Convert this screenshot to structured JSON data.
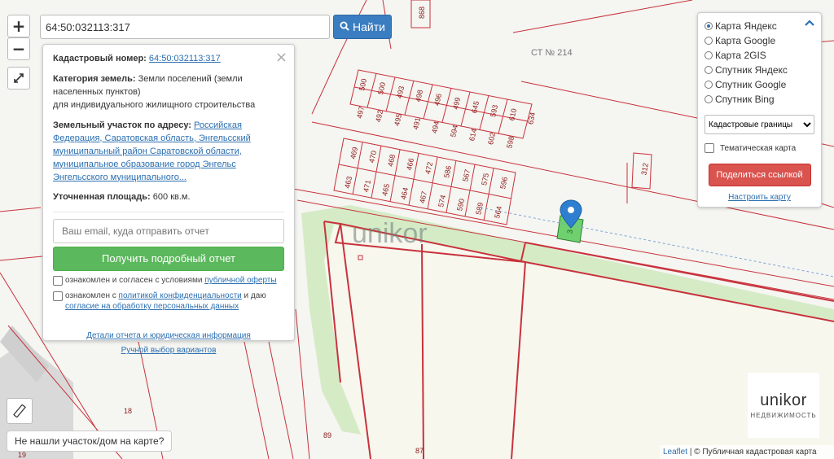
{
  "search": {
    "value": "64:50:032113:317",
    "button_label": "Найти"
  },
  "zoom": {
    "in_label": "+",
    "out_label": "−"
  },
  "info_panel": {
    "cadastral_label": "Кадастровый номер:",
    "cadastral_value": "64:50:032113:317",
    "category_label": "Категория земель:",
    "category_value": "Земли поселений (земли населенных пунктов)",
    "category_use": "для индивидуального жилищного строительства",
    "address_label": "Земельный участок по адресу:",
    "address_value": "Российская Федерация, Саратовская область, Энгельсский муниципальный район Саратовской области, муниципальное образование город Энгельс Энгельсского муниципального...",
    "area_label": "Уточненная площадь:",
    "area_value": "600 кв.м.",
    "email_placeholder": "Ваш email, куда отправить отчет",
    "report_button": "Получить подробный отчет",
    "consent1_text": "ознакомлен и согласен с условиями",
    "consent1_link": "публичной оферты",
    "consent2_text": "ознакомлен с",
    "consent2_link": "политикой конфиденциальности",
    "consent2_and": "и даю",
    "consent2_link2": "согласие на обработку персональных данных",
    "details_link": "Детали отчета и юридическая информация",
    "manual_link": "Ручной выбор вариантов"
  },
  "layers": {
    "options": [
      "Карта Яндекс",
      "Карта Google",
      "Карта 2GIS",
      "Спутник Яндекс",
      "Спутник Google",
      "Спутник Bing"
    ],
    "selected": 0,
    "dropdown_value": "Кадастровые границы",
    "thematic_label": "Тематическая карта",
    "share_button": "Поделиться ссылкой",
    "setup_link": "Настроить карту"
  },
  "not_found_button": "Не нашли участок/дом на карте?",
  "logo": {
    "brand": "unikor",
    "subtitle": "НЕДВИЖИМОСТЬ"
  },
  "watermark": "unikor",
  "attribution": {
    "leaflet": "Leaflet",
    "text": "| © Публичная кадастровая карта"
  },
  "map_labels": {
    "st": "СТ № 214",
    "top_row1": [
      "500",
      "500",
      "493",
      "498",
      "496",
      "499",
      "645",
      "593",
      "610",
      "634"
    ],
    "top_row2": [
      "497",
      "492",
      "495",
      "491",
      "494",
      "594",
      "614",
      "602",
      "598"
    ],
    "bot_row1": [
      "469",
      "470",
      "468",
      "466",
      "472",
      "586",
      "567",
      "575",
      "596"
    ],
    "bot_row2": [
      "463",
      "471",
      "465",
      "464",
      "467",
      "574",
      "590",
      "589",
      "564"
    ],
    "misc": [
      "868",
      "312",
      "18",
      "19",
      "89",
      "87",
      "3"
    ]
  },
  "colors": {
    "accent_blue": "#3a7dc0",
    "green": "#5cb85c",
    "red": "#d9534f",
    "parcel": "#c8323c",
    "highlight": "#6fd06f"
  }
}
